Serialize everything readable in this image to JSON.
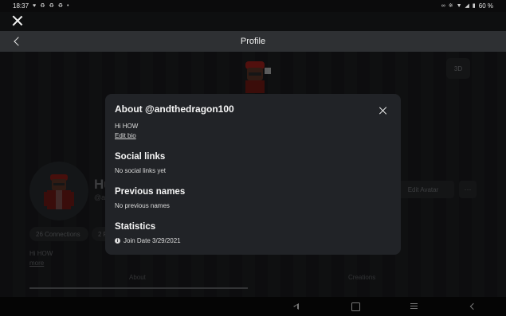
{
  "status_bar": {
    "time": "18:37",
    "left_icons": [
      "message-icon",
      "sync-icon",
      "sync-icon",
      "sync-icon",
      "dot-icon"
    ],
    "right_icons": [
      "infinity-icon",
      "bluetooth-icon",
      "wifi-icon",
      "signal-icon",
      "battery-icon"
    ],
    "battery": "60 %"
  },
  "app_bar": {
    "title": "Profile"
  },
  "profile": {
    "username_partial": "Hu",
    "handle_partial": "@ar",
    "edit_avatar_label": "Edit Avatar",
    "more_label": "···",
    "btn_3d_label": "3D",
    "connections_label": "26 Connections",
    "followers_partial": "2 F",
    "bio": "Hi HOW",
    "more_link": "more",
    "tabs": [
      {
        "label": "About"
      },
      {
        "label": "Creations"
      }
    ]
  },
  "about_modal": {
    "title": "About @andthedragon100",
    "bio": "Hi HOW",
    "edit_bio_label": "Edit bio",
    "social_links_heading": "Social links",
    "social_links_text": "No social links yet",
    "previous_names_heading": "Previous names",
    "previous_names_text": "No previous names",
    "statistics_heading": "Statistics",
    "join_date": "Join Date 3/29/2021"
  },
  "colors": {
    "modal_bg": "#212327",
    "header_bg": "#2e3033",
    "page_bg": "#161719",
    "avatar_red": "#c8241f"
  }
}
